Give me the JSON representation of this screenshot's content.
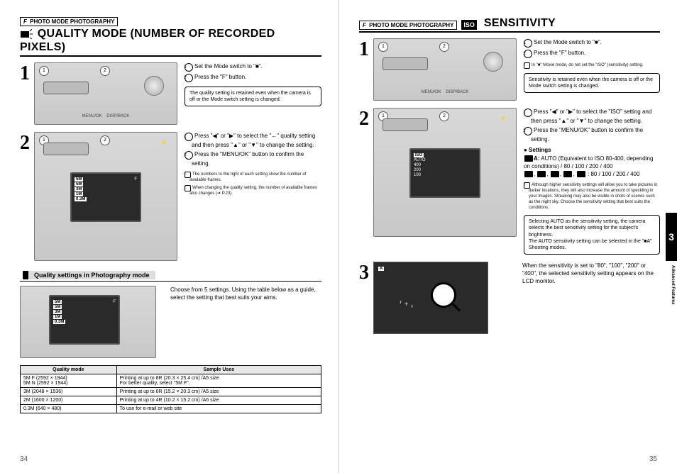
{
  "left": {
    "mode_tag": "PHOTO MODE  PHOTOGRAPHY",
    "title": "QUALITY MODE (NUMBER OF RECORDED PIXELS)",
    "step1": {
      "a": "Set the Mode switch to \"■\".",
      "b": "Press the \"F\" button.",
      "callout": "The quality setting is retained even when the camera is off or the Mode switch setting is changed."
    },
    "step2": {
      "a": "Press \"◀\" or \"▶\" to select the \"←\" quality setting and then press \"▲\" or \"▼\" to change the setting.",
      "b": "Press the \"MENU/OK\" button to confirm the setting.",
      "note1": "The numbers to the right of each setting show the number of available frames.",
      "note2": "When changing the quality setting, the number of available frames also changes (➔ P.23)."
    },
    "subhead": "Quality settings in Photography mode",
    "subtext": "Choose from 5 settings. Using the table below as a guide, select the setting that best suits your aims.",
    "table": {
      "h1": "Quality mode",
      "h2": "Sample Uses",
      "rows": [
        {
          "mode": "5M F (2592 × 1944)\n5M N (2592 × 1944)",
          "use": "Printing at up to 8R (20.3 × 25.4 cm) /A5 size\nFor better quality, select \"5M F\"."
        },
        {
          "mode": "3M (2048 × 1536)",
          "use": "Printing at up to 6R (15.2 × 20.3 cm) /A5 size"
        },
        {
          "mode": "2M (1600 × 1200)",
          "use": "Printing at up to 4R (10.2 × 15.2 cm) /A6 size"
        },
        {
          "mode": "0.3M (640 × 480)",
          "use": "To use for e-mail or web site"
        }
      ]
    },
    "page_no": "34"
  },
  "right": {
    "mode_tag": "PHOTO MODE  PHOTOGRAPHY",
    "title": "SENSITIVITY",
    "step1": {
      "a": "Set the Mode switch to \"■\".",
      "b": "Press the \"F\" button.",
      "note": "In \"■\" Movie mode, do not set the \"ISO\" (sensitivity) setting.",
      "callout": "Sensitivity is retained even when the camera is off or the Mode switch setting is changed."
    },
    "step2": {
      "a": "Press \"◀\" or \"▶\" to select the \"ISO\" setting and then press \"▲\" or \"▼\" to change the setting.",
      "b": "Press the \"MENU/OK\" button to confirm the setting.",
      "settings_hd": "● Settings",
      "settings_auto": "AUTO (Equivalent to ISO 80-400, depending on conditions) / 80 / 100 / 200 / 400",
      "settings_icons": "80 / 100 / 200 / 400",
      "note1": "Although higher sensitivity settings will allow you to take pictures in darker locations, they will also increase the amount of speckling in your images. Streaking may also be visible in shots of scenes such as the night sky. Choose the sensitivity setting that best suits the conditions.",
      "callout": "Selecting AUTO as the sensitivity setting, the camera selects the best sensitivity setting for the subject's brightness.\nThe AUTO sensitivity setting can be selected in the \"■A\" Shooting modes."
    },
    "step3": {
      "text": "When the sensitivity is set to \"80\", \"100\", \"200\" or \"400\", the selected sensitivity setting appears on the LCD monitor."
    },
    "page_no": "35",
    "tab_num": "3",
    "tab_label": "Advanced Features"
  }
}
